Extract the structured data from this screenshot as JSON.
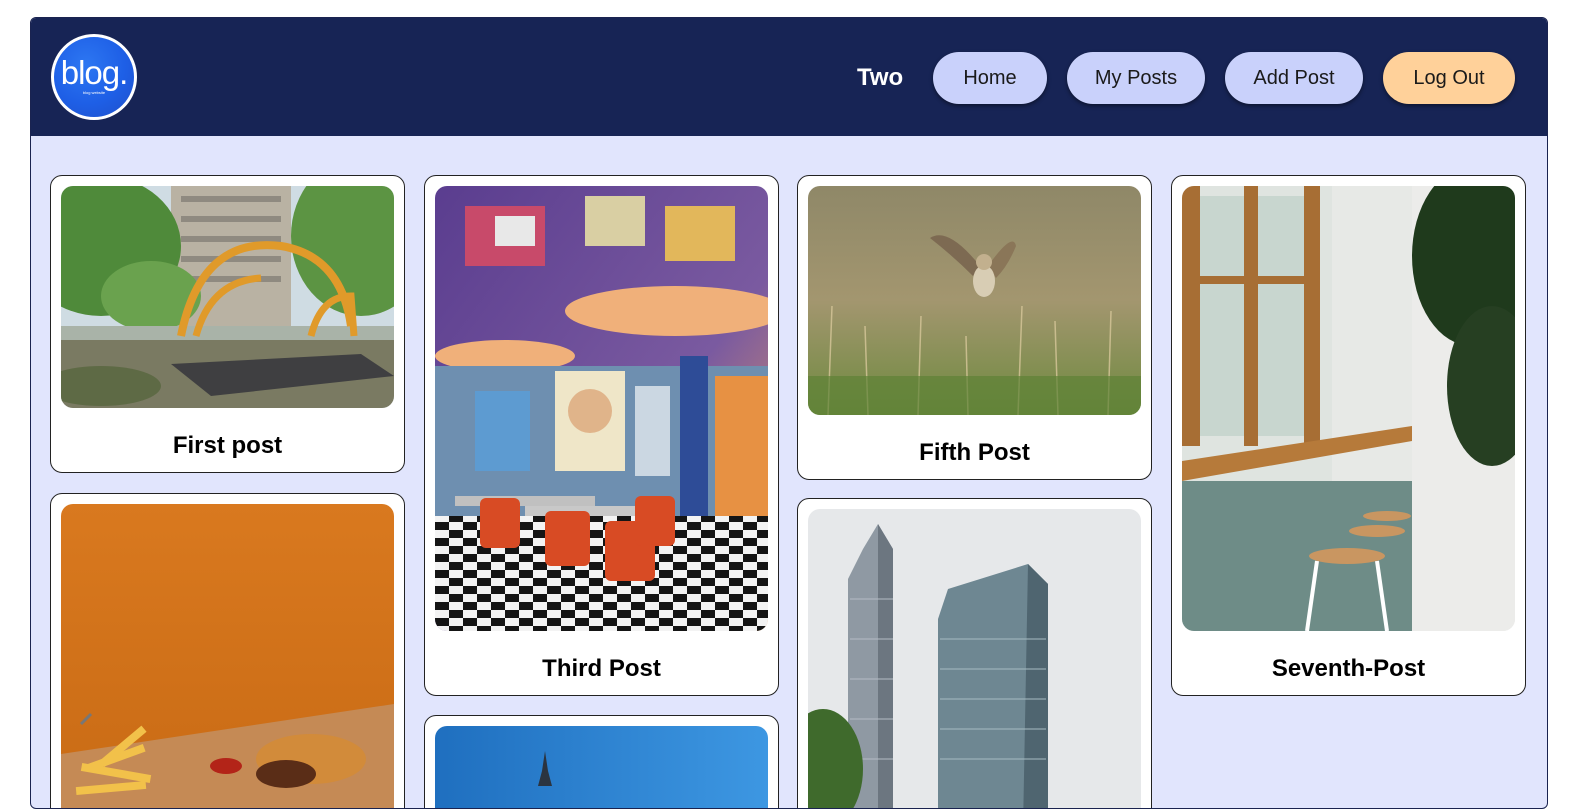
{
  "header": {
    "logo_text": "blog.",
    "logo_subtext": "blog website",
    "username": "Two",
    "nav": {
      "home": "Home",
      "my_posts": "My Posts",
      "add_post": "Add Post",
      "log_out": "Log Out"
    }
  },
  "posts": [
    {
      "title": "First post"
    },
    {
      "title": "Third Post"
    },
    {
      "title": "Fifth Post"
    },
    {
      "title": "Seventh-Post"
    },
    {
      "title": ""
    },
    {
      "title": ""
    },
    {
      "title": ""
    }
  ],
  "colors": {
    "header_bg": "#172455",
    "page_bg": "#e1e5fd",
    "nav_button": "#c9d1fb",
    "logout_button": "#ffd19a"
  }
}
